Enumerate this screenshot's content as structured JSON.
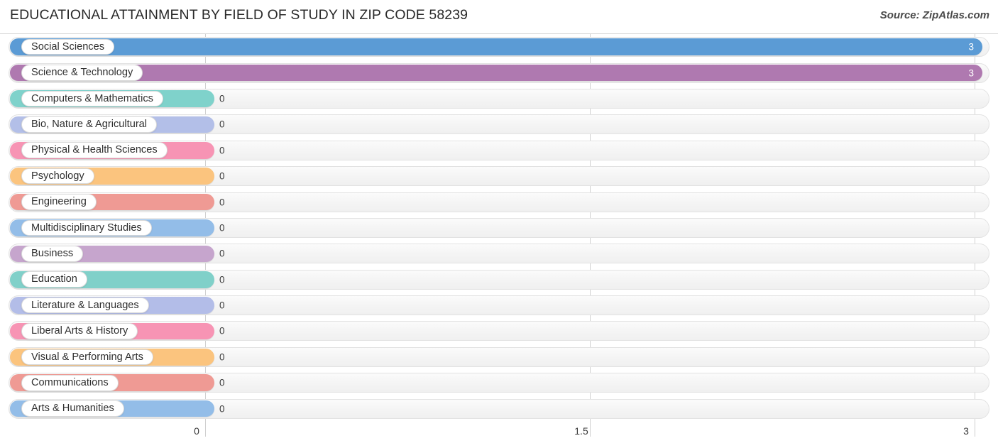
{
  "header": {
    "title": "EDUCATIONAL ATTAINMENT BY FIELD OF STUDY IN ZIP CODE 58239",
    "source": "Source: ZipAtlas.com"
  },
  "chart_data": {
    "type": "bar",
    "orientation": "horizontal",
    "title": "EDUCATIONAL ATTAINMENT BY FIELD OF STUDY IN ZIP CODE 58239",
    "xlabel": "",
    "ylabel": "",
    "xlim": [
      0,
      3
    ],
    "grid": true,
    "legend": "none",
    "tick_labels": [
      "0",
      "1.5",
      "3"
    ],
    "tick_values": [
      0,
      1.5,
      3
    ],
    "categories": [
      "Social Sciences",
      "Science & Technology",
      "Computers & Mathematics",
      "Bio, Nature & Agricultural",
      "Physical & Health Sciences",
      "Psychology",
      "Engineering",
      "Multidisciplinary Studies",
      "Business",
      "Education",
      "Literature & Languages",
      "Liberal Arts & History",
      "Visual & Performing Arts",
      "Communications",
      "Arts & Humanities"
    ],
    "values": [
      3,
      3,
      0,
      0,
      0,
      0,
      0,
      0,
      0,
      0,
      0,
      0,
      0,
      0,
      0
    ],
    "value_labels": [
      "3",
      "3",
      "0",
      "0",
      "0",
      "0",
      "0",
      "0",
      "0",
      "0",
      "0",
      "0",
      "0",
      "0",
      "0"
    ],
    "colors": [
      "#5b9bd5",
      "#af79b0",
      "#7fd2cb",
      "#b3bfe8",
      "#f794b4",
      "#fbc47e",
      "#ef9a94",
      "#93bde8",
      "#c6a5cd",
      "#80d0c9",
      "#b3bde8",
      "#f794b4",
      "#fbc47e",
      "#ef9a94",
      "#93bde8"
    ]
  }
}
